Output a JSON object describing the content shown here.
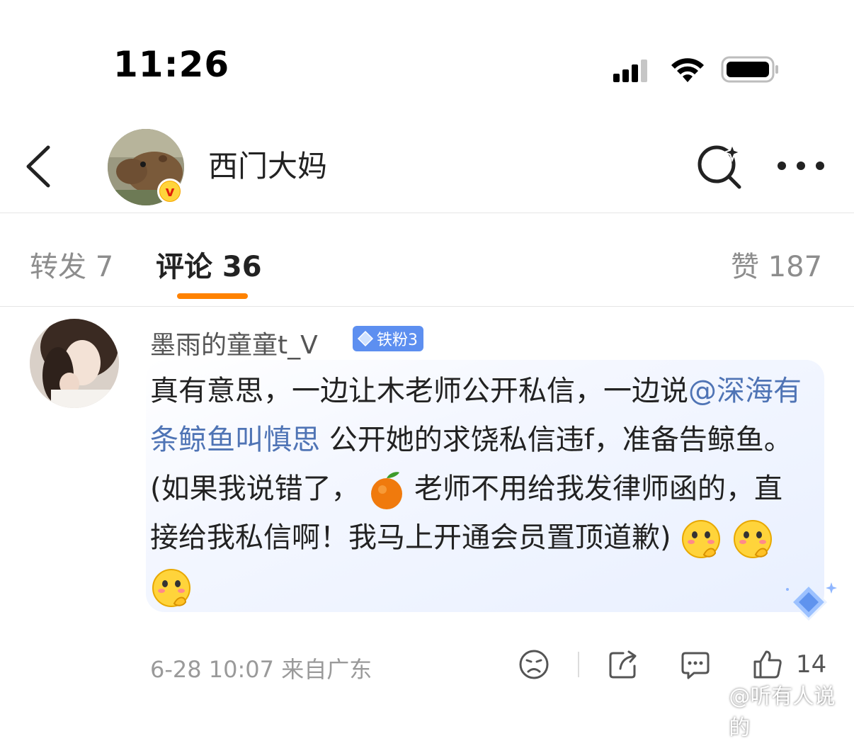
{
  "status_bar": {
    "time": "11:26"
  },
  "header": {
    "title": "西门大妈"
  },
  "tabs": {
    "repost": "转发 7",
    "comments": "评论 36",
    "likes": "赞 187"
  },
  "comment": {
    "username": "墨雨的童童t_V",
    "badge": "铁粉3",
    "text_1": "真有意思，一边让木老师公开私信，一边说",
    "mention": "@深海有条鲸鱼叫慎思",
    "text_2": " 公开她的求饶私信违f，准备告鲸鱼。(如果我说错了，",
    "text_3": "老师不用给我发律师函的，直接给我私信啊！我马上开通会员置顶道歉)",
    "meta": "6-28 10:07  来自广东",
    "like_count": "14"
  },
  "watermark": "@听有人说的",
  "colors": {
    "accent": "#ff8200",
    "mention": "#4f74b5",
    "badge": "#5d8ff0"
  },
  "icons": [
    "back-icon",
    "search-icon",
    "more-icon",
    "verified-icon",
    "dislike-icon",
    "share-icon",
    "comment-icon",
    "thumbs-up-icon",
    "orange-emoji-icon",
    "thinking-emoji-icon",
    "diamond-icon",
    "weibo-icon"
  ]
}
